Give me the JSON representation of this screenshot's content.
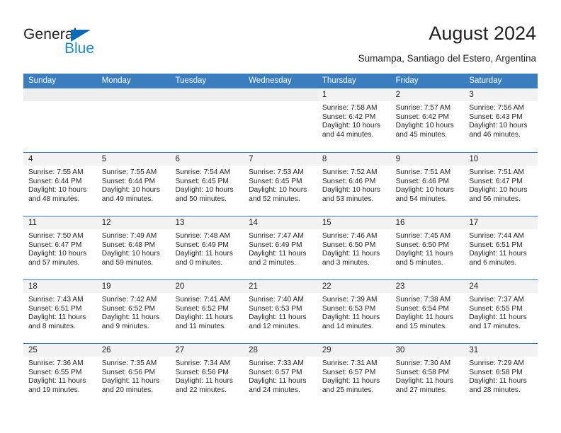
{
  "brand": {
    "name_part1": "General",
    "name_part2": "Blue",
    "triangle_color": "#0b6cb5",
    "blue_color": "#1b8ad6"
  },
  "header": {
    "title": "August 2024",
    "subtitle": "Sumampa, Santiago del Estero, Argentina"
  },
  "theme": {
    "header_row_bg": "#3a7ebf",
    "day_number_bg": "#f2f2f2",
    "grid_line": "#3a7ebf",
    "text": "#231f20"
  },
  "weekdays": [
    "Sunday",
    "Monday",
    "Tuesday",
    "Wednesday",
    "Thursday",
    "Friday",
    "Saturday"
  ],
  "weeks": [
    [
      {
        "day": "",
        "empty": true
      },
      {
        "day": "",
        "empty": true
      },
      {
        "day": "",
        "empty": true
      },
      {
        "day": "",
        "empty": true
      },
      {
        "day": "1",
        "sunrise": "Sunrise: 7:58 AM",
        "sunset": "Sunset: 6:42 PM",
        "daylight": "Daylight: 10 hours and 44 minutes."
      },
      {
        "day": "2",
        "sunrise": "Sunrise: 7:57 AM",
        "sunset": "Sunset: 6:42 PM",
        "daylight": "Daylight: 10 hours and 45 minutes."
      },
      {
        "day": "3",
        "sunrise": "Sunrise: 7:56 AM",
        "sunset": "Sunset: 6:43 PM",
        "daylight": "Daylight: 10 hours and 46 minutes."
      }
    ],
    [
      {
        "day": "4",
        "sunrise": "Sunrise: 7:55 AM",
        "sunset": "Sunset: 6:44 PM",
        "daylight": "Daylight: 10 hours and 48 minutes."
      },
      {
        "day": "5",
        "sunrise": "Sunrise: 7:55 AM",
        "sunset": "Sunset: 6:44 PM",
        "daylight": "Daylight: 10 hours and 49 minutes."
      },
      {
        "day": "6",
        "sunrise": "Sunrise: 7:54 AM",
        "sunset": "Sunset: 6:45 PM",
        "daylight": "Daylight: 10 hours and 50 minutes."
      },
      {
        "day": "7",
        "sunrise": "Sunrise: 7:53 AM",
        "sunset": "Sunset: 6:45 PM",
        "daylight": "Daylight: 10 hours and 52 minutes."
      },
      {
        "day": "8",
        "sunrise": "Sunrise: 7:52 AM",
        "sunset": "Sunset: 6:46 PM",
        "daylight": "Daylight: 10 hours and 53 minutes."
      },
      {
        "day": "9",
        "sunrise": "Sunrise: 7:51 AM",
        "sunset": "Sunset: 6:46 PM",
        "daylight": "Daylight: 10 hours and 54 minutes."
      },
      {
        "day": "10",
        "sunrise": "Sunrise: 7:51 AM",
        "sunset": "Sunset: 6:47 PM",
        "daylight": "Daylight: 10 hours and 56 minutes."
      }
    ],
    [
      {
        "day": "11",
        "sunrise": "Sunrise: 7:50 AM",
        "sunset": "Sunset: 6:47 PM",
        "daylight": "Daylight: 10 hours and 57 minutes."
      },
      {
        "day": "12",
        "sunrise": "Sunrise: 7:49 AM",
        "sunset": "Sunset: 6:48 PM",
        "daylight": "Daylight: 10 hours and 59 minutes."
      },
      {
        "day": "13",
        "sunrise": "Sunrise: 7:48 AM",
        "sunset": "Sunset: 6:49 PM",
        "daylight": "Daylight: 11 hours and 0 minutes."
      },
      {
        "day": "14",
        "sunrise": "Sunrise: 7:47 AM",
        "sunset": "Sunset: 6:49 PM",
        "daylight": "Daylight: 11 hours and 2 minutes."
      },
      {
        "day": "15",
        "sunrise": "Sunrise: 7:46 AM",
        "sunset": "Sunset: 6:50 PM",
        "daylight": "Daylight: 11 hours and 3 minutes."
      },
      {
        "day": "16",
        "sunrise": "Sunrise: 7:45 AM",
        "sunset": "Sunset: 6:50 PM",
        "daylight": "Daylight: 11 hours and 5 minutes."
      },
      {
        "day": "17",
        "sunrise": "Sunrise: 7:44 AM",
        "sunset": "Sunset: 6:51 PM",
        "daylight": "Daylight: 11 hours and 6 minutes."
      }
    ],
    [
      {
        "day": "18",
        "sunrise": "Sunrise: 7:43 AM",
        "sunset": "Sunset: 6:51 PM",
        "daylight": "Daylight: 11 hours and 8 minutes."
      },
      {
        "day": "19",
        "sunrise": "Sunrise: 7:42 AM",
        "sunset": "Sunset: 6:52 PM",
        "daylight": "Daylight: 11 hours and 9 minutes."
      },
      {
        "day": "20",
        "sunrise": "Sunrise: 7:41 AM",
        "sunset": "Sunset: 6:52 PM",
        "daylight": "Daylight: 11 hours and 11 minutes."
      },
      {
        "day": "21",
        "sunrise": "Sunrise: 7:40 AM",
        "sunset": "Sunset: 6:53 PM",
        "daylight": "Daylight: 11 hours and 12 minutes."
      },
      {
        "day": "22",
        "sunrise": "Sunrise: 7:39 AM",
        "sunset": "Sunset: 6:53 PM",
        "daylight": "Daylight: 11 hours and 14 minutes."
      },
      {
        "day": "23",
        "sunrise": "Sunrise: 7:38 AM",
        "sunset": "Sunset: 6:54 PM",
        "daylight": "Daylight: 11 hours and 15 minutes."
      },
      {
        "day": "24",
        "sunrise": "Sunrise: 7:37 AM",
        "sunset": "Sunset: 6:55 PM",
        "daylight": "Daylight: 11 hours and 17 minutes."
      }
    ],
    [
      {
        "day": "25",
        "sunrise": "Sunrise: 7:36 AM",
        "sunset": "Sunset: 6:55 PM",
        "daylight": "Daylight: 11 hours and 19 minutes."
      },
      {
        "day": "26",
        "sunrise": "Sunrise: 7:35 AM",
        "sunset": "Sunset: 6:56 PM",
        "daylight": "Daylight: 11 hours and 20 minutes."
      },
      {
        "day": "27",
        "sunrise": "Sunrise: 7:34 AM",
        "sunset": "Sunset: 6:56 PM",
        "daylight": "Daylight: 11 hours and 22 minutes."
      },
      {
        "day": "28",
        "sunrise": "Sunrise: 7:33 AM",
        "sunset": "Sunset: 6:57 PM",
        "daylight": "Daylight: 11 hours and 24 minutes."
      },
      {
        "day": "29",
        "sunrise": "Sunrise: 7:31 AM",
        "sunset": "Sunset: 6:57 PM",
        "daylight": "Daylight: 11 hours and 25 minutes."
      },
      {
        "day": "30",
        "sunrise": "Sunrise: 7:30 AM",
        "sunset": "Sunset: 6:58 PM",
        "daylight": "Daylight: 11 hours and 27 minutes."
      },
      {
        "day": "31",
        "sunrise": "Sunrise: 7:29 AM",
        "sunset": "Sunset: 6:58 PM",
        "daylight": "Daylight: 11 hours and 28 minutes."
      }
    ]
  ]
}
